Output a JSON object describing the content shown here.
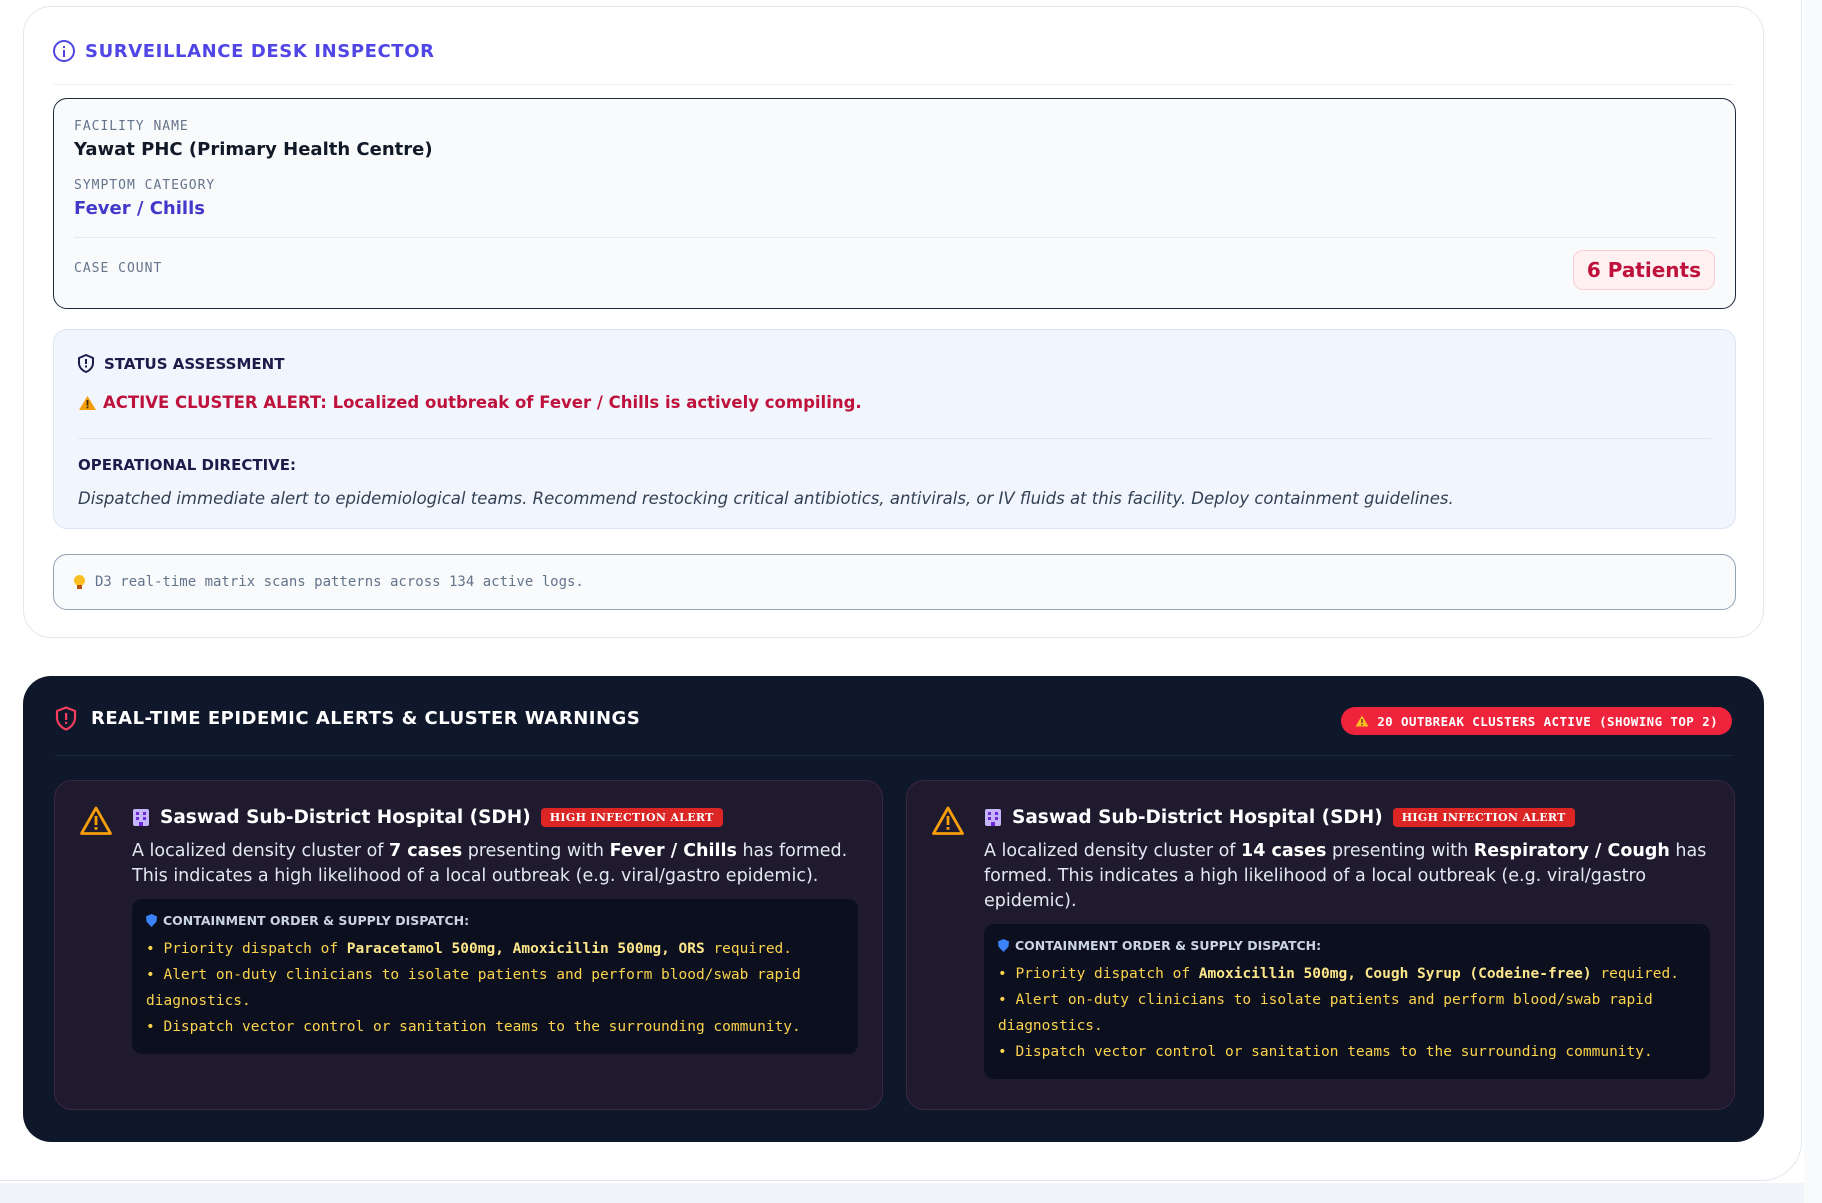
{
  "inspector": {
    "title": "SURVEILLANCE DESK INSPECTOR",
    "facility_label": "FACILITY NAME",
    "facility_value": "Yawat PHC (Primary Health Centre)",
    "symptom_label": "SYMPTOM CATEGORY",
    "symptom_value": "Fever / Chills",
    "case_label": "CASE COUNT",
    "case_value": "6 Patients",
    "status_title": "STATUS ASSESSMENT",
    "alert_text": "ACTIVE CLUSTER ALERT: Localized outbreak of Fever / Chills is actively compiling.",
    "directive_label": "OPERATIONAL DIRECTIVE:",
    "directive_text": "Dispatched immediate alert to epidemiological teams. Recommend restocking critical antibiotics, antivirals, or IV fluids at this facility. Deploy containment guidelines.",
    "hint_text": "D3 real-time matrix scans patterns across 134 active logs."
  },
  "alerts": {
    "title": "REAL-TIME EPIDEMIC ALERTS & CLUSTER WARNINGS",
    "badge": "20 OUTBREAK CLUSTERS ACTIVE (SHOWING TOP 2)",
    "cards": [
      {
        "hospital": "Saswad Sub-District Hospital (SDH)",
        "badge": "HIGH INFECTION ALERT",
        "desc_pre": "A localized density cluster of ",
        "cases": "7 cases",
        "desc_mid": " presenting with ",
        "symptom": "Fever / Chills",
        "desc_post": " has formed. This indicates a high likelihood of a local outbreak (e.g. viral/gastro epidemic).",
        "order_title": "CONTAINMENT ORDER & SUPPLY DISPATCH:",
        "line1_pre": "• Priority dispatch of ",
        "line1_meds": "Paracetamol 500mg, Amoxicillin 500mg, ORS",
        "line1_post": " required.",
        "line2": "• Alert on-duty clinicians to isolate patients and perform blood/swab rapid diagnostics.",
        "line3": "• Dispatch vector control or sanitation teams to the surrounding community."
      },
      {
        "hospital": "Saswad Sub-District Hospital (SDH)",
        "badge": "HIGH INFECTION ALERT",
        "desc_pre": "A localized density cluster of ",
        "cases": "14 cases",
        "desc_mid": " presenting with ",
        "symptom": "Respiratory / Cough",
        "desc_post": " has formed. This indicates a high likelihood of a local outbreak (e.g. viral/gastro epidemic).",
        "order_title": "CONTAINMENT ORDER & SUPPLY DISPATCH:",
        "line1_pre": "• Priority dispatch of ",
        "line1_meds": "Amoxicillin 500mg, Cough Syrup (Codeine-free)",
        "line1_post": " required.",
        "line2": "• Alert on-duty clinicians to isolate patients and perform blood/swab rapid diagnostics.",
        "line3": "• Dispatch vector control or sanitation teams to the surrounding community."
      }
    ]
  },
  "colors": {
    "accent": "#4f46e5",
    "alert_red": "#be123c",
    "dark_panel": "#0f172a",
    "badge_red": "#ef233c",
    "directive_amber": "#fcd34d"
  },
  "icons": [
    "info-icon",
    "shield-icon",
    "warning-icon",
    "bulb-icon",
    "hospital-icon"
  ]
}
